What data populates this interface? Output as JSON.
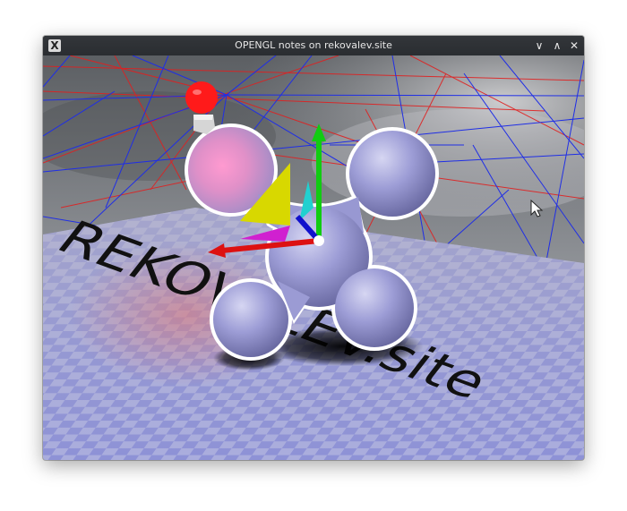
{
  "window": {
    "title": "OPENGL notes on rekovalev.site",
    "app_icon": "X",
    "controls": {
      "minimize": "∨",
      "maximize": "∧",
      "close": "✕"
    }
  },
  "scene": {
    "floor_text": "REKOVALEV.site",
    "colors": {
      "sky": "#7a7d82",
      "grid_blue": "#1f2ee6",
      "grid_red": "#e02020",
      "floor": "#8c90d8",
      "checker": "#a8abdc",
      "molecule": "#9a9ad6",
      "outline": "#ffffff",
      "light_bulb": "#ff1a1a",
      "axis_x": "#dd1111",
      "axis_y": "#11cc11",
      "axis_z": "#1111cc",
      "triangle_yellow": "#d8d800",
      "triangle_cyan": "#22d0d0",
      "triangle_magenta": "#d020d0"
    },
    "icons": [
      "light-bulb-icon",
      "mouse-cursor-icon"
    ]
  }
}
